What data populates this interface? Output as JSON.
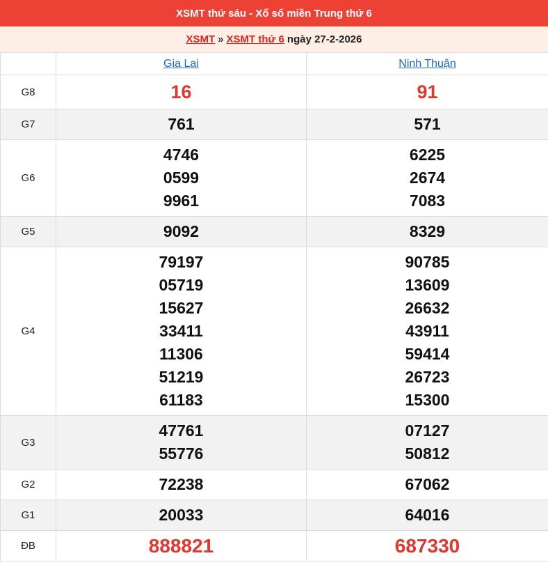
{
  "header": {
    "title": "XSMT thứ sáu - Xổ số miền Trung thứ 6"
  },
  "breadcrumb": {
    "link1": "XSMT",
    "separator": "»",
    "link2": "XSMT thứ 6",
    "date_text": "ngày 27-2-2026"
  },
  "provinces": [
    "Gia Lai",
    "Ninh Thuận"
  ],
  "prizes": [
    {
      "label": "G8",
      "values": [
        [
          "16"
        ],
        [
          "91"
        ]
      ]
    },
    {
      "label": "G7",
      "values": [
        [
          "761"
        ],
        [
          "571"
        ]
      ]
    },
    {
      "label": "G6",
      "values": [
        [
          "4746",
          "0599",
          "9961"
        ],
        [
          "6225",
          "2674",
          "7083"
        ]
      ]
    },
    {
      "label": "G5",
      "values": [
        [
          "9092"
        ],
        [
          "8329"
        ]
      ]
    },
    {
      "label": "G4",
      "values": [
        [
          "79197",
          "05719",
          "15627",
          "33411",
          "11306",
          "51219",
          "61183"
        ],
        [
          "90785",
          "13609",
          "26632",
          "43911",
          "59414",
          "26723",
          "15300"
        ]
      ]
    },
    {
      "label": "G3",
      "values": [
        [
          "47761",
          "55776"
        ],
        [
          "07127",
          "50812"
        ]
      ]
    },
    {
      "label": "G2",
      "values": [
        [
          "72238"
        ],
        [
          "67062"
        ]
      ]
    },
    {
      "label": "G1",
      "values": [
        [
          "20033"
        ],
        [
          "64016"
        ]
      ]
    },
    {
      "label": "ĐB",
      "values": [
        [
          "888821"
        ],
        [
          "687330"
        ]
      ]
    }
  ],
  "colors": {
    "title_bg": "#ed4136",
    "breadcrumb_bg": "#fdeee6",
    "highlight_red": "#e0382e",
    "link_blue": "#1a66c4",
    "alt_row": "#f2f2f2"
  }
}
